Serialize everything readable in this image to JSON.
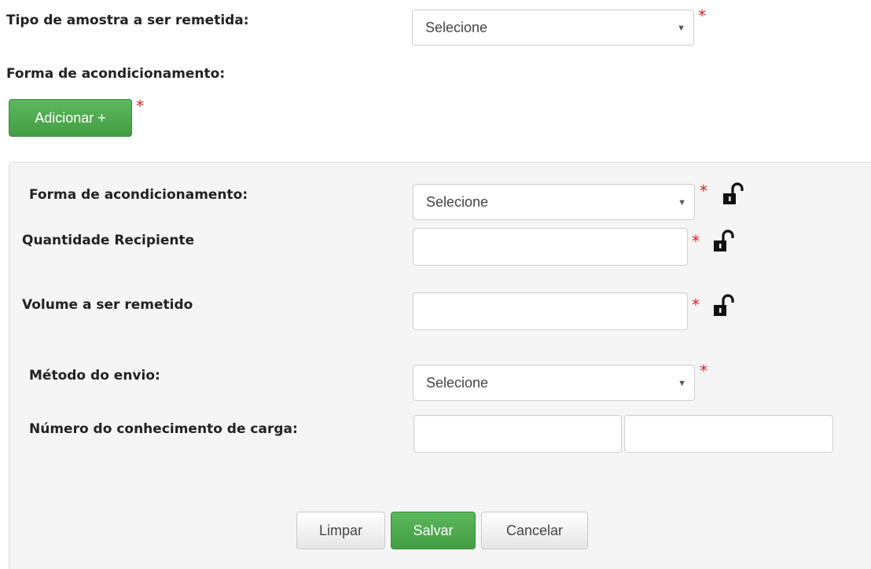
{
  "top": {
    "tipo_amostra_label": "Tipo de amostra a ser remetida:",
    "tipo_amostra_value": "Selecione",
    "forma_label": "Forma de acondicionamento:",
    "adicionar_label": "Adicionar +"
  },
  "panel": {
    "forma_label": "Forma de acondicionamento:",
    "forma_value": "Selecione",
    "quantidade_label": "Quantidade Recipiente",
    "quantidade_value": "",
    "volume_label": "Volume a ser remetido",
    "volume_value": "",
    "metodo_label": "Método do envio:",
    "metodo_value": "Selecione",
    "numero_label": "Número do conhecimento de carga:",
    "numero_value_1": "",
    "numero_value_2": ""
  },
  "actions": {
    "limpar": "Limpar",
    "salvar": "Salvar",
    "cancelar": "Cancelar"
  },
  "required_marker": "*",
  "icons": {
    "dropdown": "chevron-down-icon",
    "lock": "unlock-icon"
  },
  "colors": {
    "required": "#d9231f",
    "primary_green": "#5cb85c",
    "panel_bg": "#f5f5f5"
  }
}
